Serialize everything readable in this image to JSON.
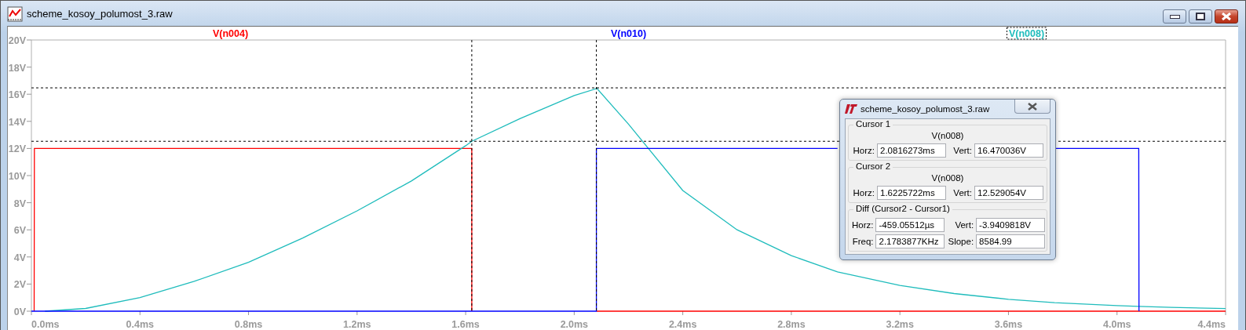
{
  "window": {
    "title": "scheme_kosoy_polumost_3.raw"
  },
  "plot": {
    "legend": [
      {
        "selected": false
      },
      {
        "selected": false
      },
      {
        "selected": true
      }
    ],
    "chart_data": {
      "type": "line",
      "x": [
        0,
        0.01,
        0.011,
        0.05,
        0.2,
        0.4,
        0.6,
        0.8,
        1.0,
        1.2,
        1.4,
        1.6,
        1.6225,
        1.6226,
        1.8,
        2.0,
        2.08,
        2.0816,
        2.0817,
        2.2,
        2.4,
        2.6,
        2.8,
        2.97,
        3.2,
        3.4,
        3.6,
        3.77,
        4.0,
        4.08,
        4.081,
        4.2,
        4.4
      ],
      "series": [
        {
          "name": "V(n004)",
          "color": "#ff0000",
          "values": [
            null,
            0,
            12,
            12,
            12,
            12,
            12,
            12,
            12,
            12,
            12,
            12,
            12,
            0,
            null,
            null,
            null,
            0,
            0,
            0,
            0,
            0,
            0,
            0,
            0,
            0,
            0,
            0,
            0,
            0,
            0,
            0,
            0
          ]
        },
        {
          "name": "V(n010)",
          "color": "#0000ff",
          "values": [
            0,
            0,
            0,
            0,
            0,
            0,
            0,
            0,
            0,
            0,
            0,
            0,
            0,
            0,
            0,
            0,
            0,
            0,
            12,
            12,
            12,
            12,
            12,
            12,
            null,
            null,
            null,
            12,
            12,
            12,
            0,
            null,
            null
          ]
        },
        {
          "name": "V(n008)",
          "color": "#1fbcbc",
          "values": [
            null,
            null,
            null,
            0,
            0.2,
            1.0,
            2.2,
            3.6,
            5.4,
            7.4,
            9.6,
            12.2,
            12.53,
            12.53,
            14.2,
            15.9,
            16.4,
            16.47,
            16.47,
            13.8,
            8.9,
            6.0,
            4.1,
            2.9,
            1.9,
            1.3,
            0.88,
            0.63,
            0.41,
            0.35,
            0.35,
            0.28,
            0.19
          ]
        }
      ],
      "xlim": [
        0,
        4.4
      ],
      "ylim": [
        0,
        20
      ],
      "xticks": [
        {
          "value": 0,
          "label": "0.0ms"
        },
        {
          "value": 0.4,
          "label": "0.4ms"
        },
        {
          "value": 0.8,
          "label": "0.8ms"
        },
        {
          "value": 1.2,
          "label": "1.2ms"
        },
        {
          "value": 1.6,
          "label": "1.6ms"
        },
        {
          "value": 2.0,
          "label": "2.0ms"
        },
        {
          "value": 2.4,
          "label": "2.4ms"
        },
        {
          "value": 2.8,
          "label": "2.8ms"
        },
        {
          "value": 3.2,
          "label": "3.2ms"
        },
        {
          "value": 3.6,
          "label": "3.6ms"
        },
        {
          "value": 4.0,
          "label": "4.0ms"
        },
        {
          "value": 4.4,
          "label": "4.4ms"
        }
      ],
      "yticks": [
        {
          "value": 0,
          "label": "0V"
        },
        {
          "value": 2,
          "label": "2V"
        },
        {
          "value": 4,
          "label": "4V"
        },
        {
          "value": 6,
          "label": "6V"
        },
        {
          "value": 8,
          "label": "8V"
        },
        {
          "value": 10,
          "label": "10V"
        },
        {
          "value": 12,
          "label": "12V"
        },
        {
          "value": 14,
          "label": "14V"
        },
        {
          "value": 16,
          "label": "16V"
        },
        {
          "value": 18,
          "label": "18V"
        },
        {
          "value": 20,
          "label": "20V"
        }
      ],
      "ref_lines": [
        {
          "axis": "x",
          "value": 2.0816273
        },
        {
          "axis": "y",
          "value": 16.470036
        },
        {
          "axis": "x",
          "value": 1.6225722
        },
        {
          "axis": "y",
          "value": 12.529054
        }
      ]
    }
  },
  "cursor_dialog": {
    "title": "scheme_kosoy_polumost_3.raw",
    "groups": [
      {
        "title": "Cursor 1",
        "trace": "V(n008)",
        "fields": [
          {
            "label": "Horz:",
            "value": "2.0816273ms"
          },
          {
            "label": "Vert:",
            "value": "16.470036V"
          }
        ]
      },
      {
        "title": "Cursor 2",
        "trace": "V(n008)",
        "fields": [
          {
            "label": "Horz:",
            "value": "1.6225722ms"
          },
          {
            "label": "Vert:",
            "value": "12.529054V"
          }
        ]
      },
      {
        "title": "Diff (Cursor2 - Cursor1)",
        "fields": [
          {
            "label": "Horz:",
            "value": "-459.05512µs"
          },
          {
            "label": "Vert:",
            "value": "-3.9409818V"
          },
          {
            "label": "Freq:",
            "value": "2.1783877KHz"
          },
          {
            "label": "Slope:",
            "value": "8584.99"
          }
        ]
      }
    ]
  }
}
